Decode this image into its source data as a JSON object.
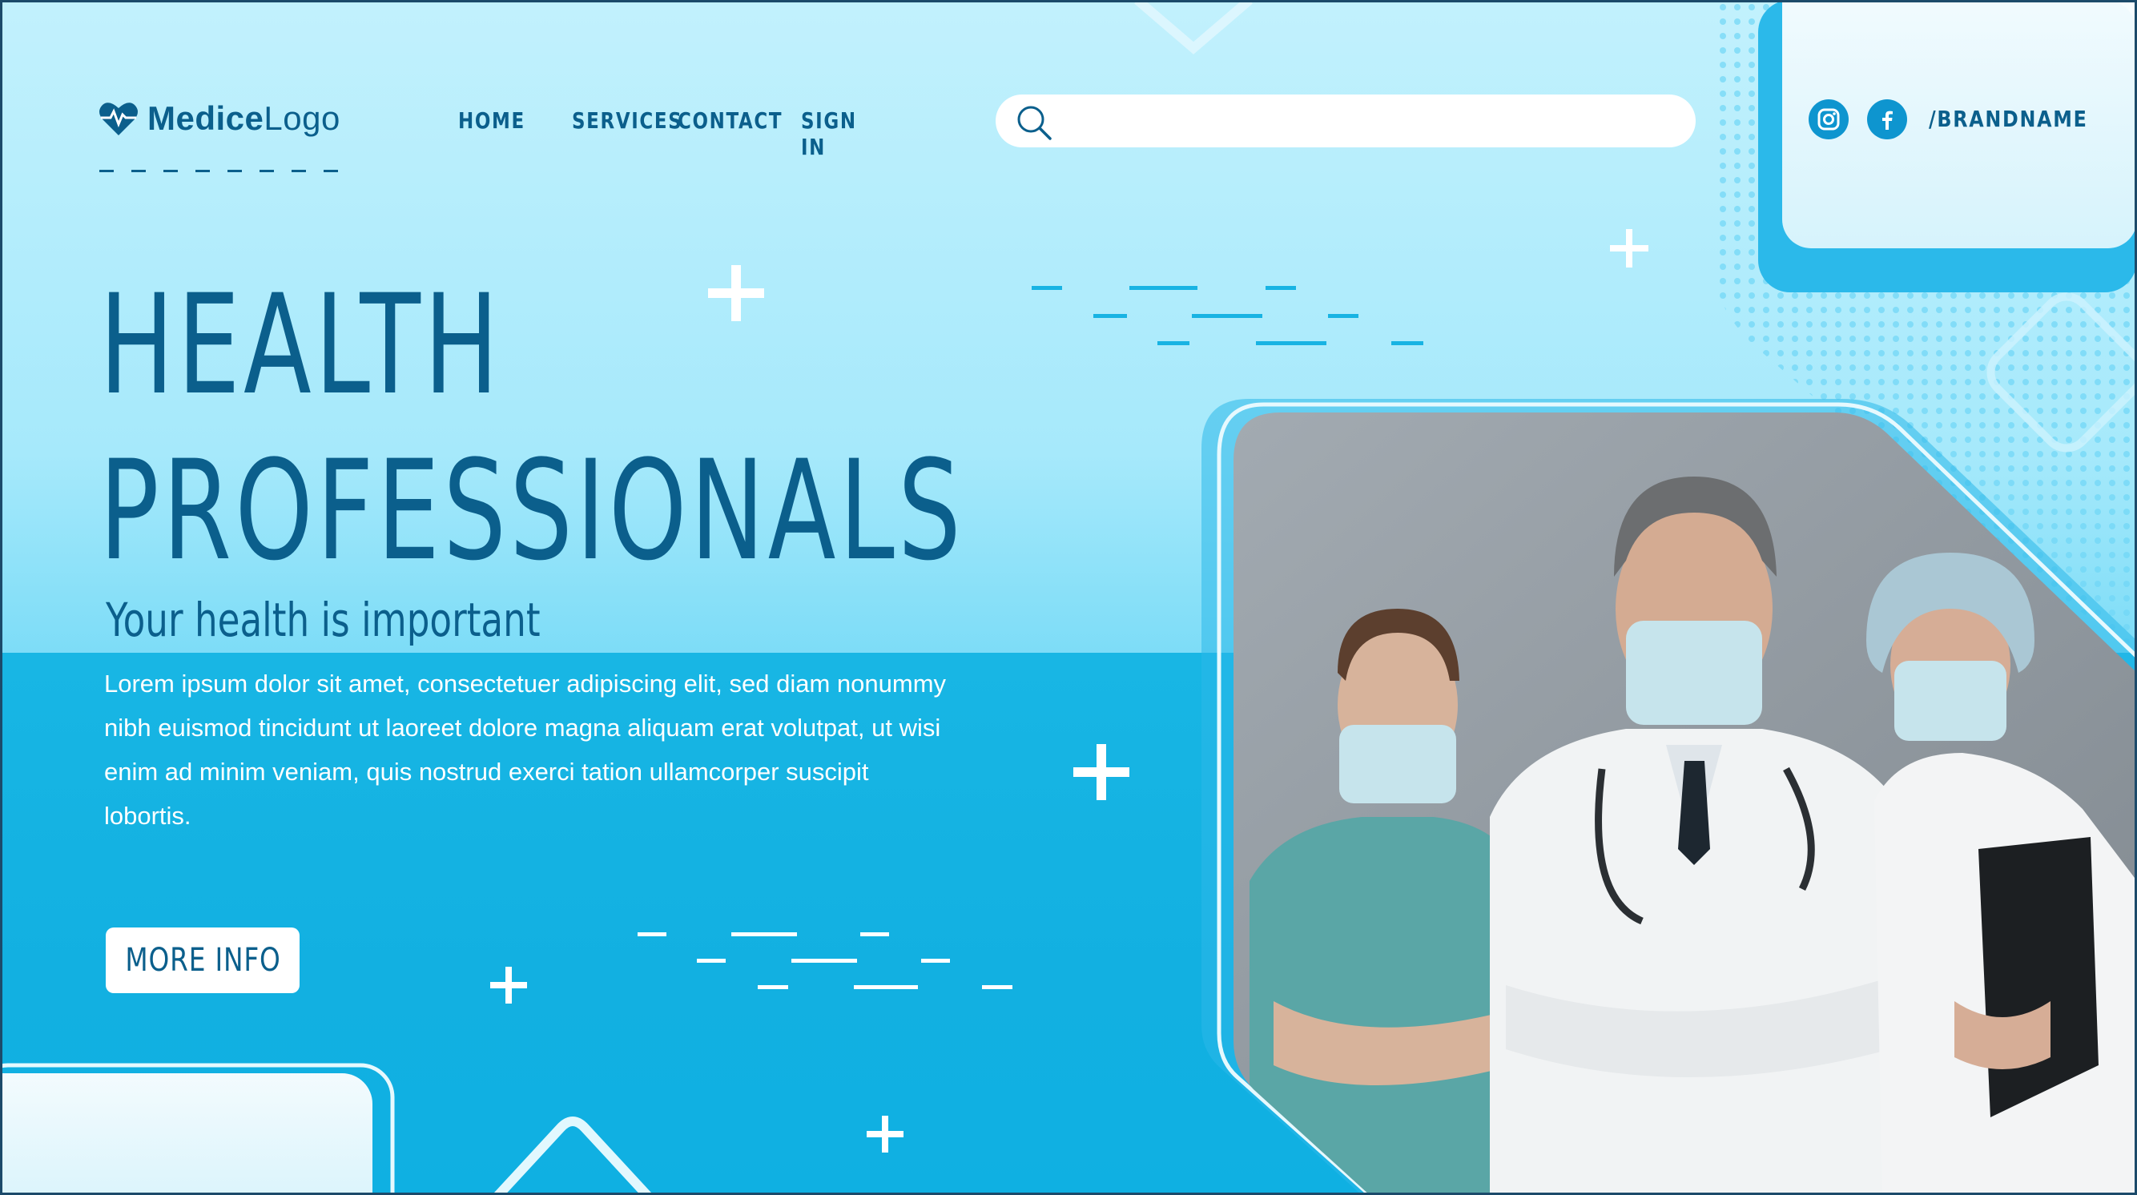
{
  "brand": {
    "logo_bold": "Medice",
    "logo_light": "Logo",
    "handle": "/BRANDNAME"
  },
  "nav": {
    "items": [
      {
        "label": "HOME"
      },
      {
        "label": "SERVICES"
      },
      {
        "label": "CONTACT"
      },
      {
        "label": "SIGN IN"
      }
    ]
  },
  "search": {
    "value": "",
    "placeholder": ""
  },
  "social": {
    "icons": [
      "instagram-icon",
      "facebook-icon"
    ]
  },
  "hero": {
    "title_line1": "HEALTH",
    "title_line2": "PROFESSIONALS",
    "subtitle": "Your health is important",
    "body": "Lorem ipsum dolor sit amet, consectetuer adipiscing elit, sed diam nonummy nibh euismod tincidunt ut laoreet dolore magna aliquam erat volutpat, ut wisi enim ad minim veniam, quis nostrud exerci tation ullamcorper suscipit lobortis.",
    "button_label": "MORE INFO"
  },
  "colors": {
    "primary_text": "#0b5f8c",
    "accent_blue": "#12b0e1",
    "light_sky": "#c2f1fd",
    "white": "#ffffff"
  }
}
